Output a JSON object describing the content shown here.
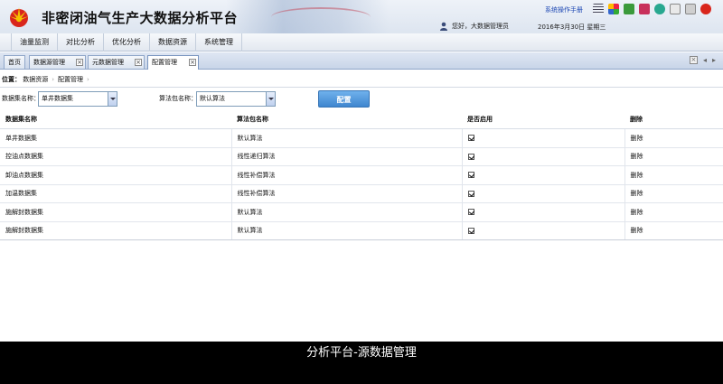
{
  "header": {
    "title": "非密闭油气生产大数据分析平台",
    "manual_link": "系统操作手册",
    "user_greeting": "您好，大数据管理员",
    "date": "2016年3月30日 星期三",
    "toolbar_icons": [
      "list-icon",
      "grid-icon",
      "download-icon",
      "tag-icon",
      "refresh-icon",
      "document-icon",
      "message-icon",
      "power-icon"
    ]
  },
  "menu": {
    "items": [
      "油量监测",
      "对比分析",
      "优化分析",
      "数据资源",
      "系统管理"
    ]
  },
  "tabs": [
    {
      "label": "首页",
      "closable": false,
      "active": false
    },
    {
      "label": "数据源管理",
      "closable": true,
      "active": false
    },
    {
      "label": "元数据管理",
      "closable": true,
      "active": false
    },
    {
      "label": "配置管理",
      "closable": true,
      "active": true
    }
  ],
  "breadcrumb": {
    "label": "位置：",
    "items": [
      "数据资源",
      "配置管理"
    ]
  },
  "filter": {
    "dataset_label": "数据集名称：",
    "dataset_value": "单井数据集",
    "algo_label": "算法包名称：",
    "algo_value": "默认算法",
    "config_button": "配置"
  },
  "table": {
    "columns": [
      "数据集名称",
      "算法包名称",
      "是否启用",
      "删除"
    ],
    "rows": [
      {
        "dataset": "单井数据集",
        "algo": "默认算法",
        "enabled": true,
        "delete": "删除"
      },
      {
        "dataset": "控油点数据集",
        "algo": "线性递归算法",
        "enabled": true,
        "delete": "删除"
      },
      {
        "dataset": "卸油点数据集",
        "algo": "线性补偿算法",
        "enabled": true,
        "delete": "删除"
      },
      {
        "dataset": "加温数据集",
        "algo": "线性补偿算法",
        "enabled": true,
        "delete": "删除"
      },
      {
        "dataset": "施解封数据集",
        "algo": "默认算法",
        "enabled": true,
        "delete": "删除"
      },
      {
        "dataset": "施解封数据集",
        "algo": "默认算法",
        "enabled": true,
        "delete": "删除"
      }
    ]
  },
  "caption": "分析平台-源数据管理",
  "colors": {
    "accent": "#3f86cf",
    "link": "#1b46b3",
    "logo_red": "#d9261c",
    "logo_yellow": "#f3c200"
  }
}
